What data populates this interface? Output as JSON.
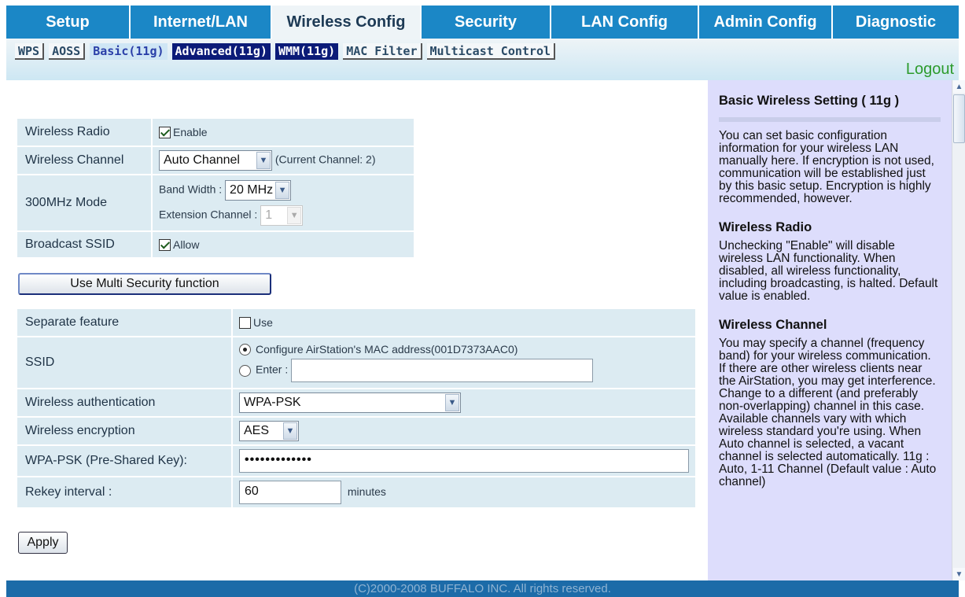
{
  "nav": {
    "tabs": [
      "Setup",
      "Internet/LAN",
      "Wireless Config",
      "Security",
      "LAN Config",
      "Admin Config",
      "Diagnostic"
    ],
    "active": "Wireless Config"
  },
  "subnav": {
    "items": [
      "WPS",
      "AOSS",
      "Basic(11g)",
      "Advanced(11g)",
      "WMM(11g)",
      "MAC Filter",
      "Multicast Control"
    ]
  },
  "logout": "Logout",
  "form1": {
    "radio_label": "Wireless Radio",
    "radio_enable": "Enable",
    "channel_label": "Wireless Channel",
    "channel_value": "Auto Channel",
    "channel_current": "(Current Channel: 2)",
    "mode_label": "300MHz Mode",
    "bandwidth_label": "Band Width :",
    "bandwidth_value": "20 MHz",
    "ext_label": "Extension Channel :",
    "ext_value": "1",
    "ssid_bc_label": "Broadcast SSID",
    "ssid_bc_allow": "Allow"
  },
  "multi_button": "Use Multi Security function",
  "form2": {
    "separate_label": "Separate feature",
    "separate_use": "Use",
    "ssid_label": "SSID",
    "ssid_opt1": "Configure AirStation's MAC address(001D7373AAC0)",
    "ssid_opt2": "Enter :",
    "ssid_enter_value": "",
    "auth_label": "Wireless authentication",
    "auth_value": "WPA-PSK",
    "enc_label": "Wireless encryption",
    "enc_value": "AES",
    "psk_label": "WPA-PSK (Pre-Shared Key):",
    "psk_value": "•••••••••••••",
    "rekey_label": "Rekey interval :",
    "rekey_value": "60",
    "rekey_unit": "minutes"
  },
  "apply_button": "Apply",
  "help": {
    "title": "Basic Wireless Setting ( 11g )",
    "intro": "You can set basic configuration information for your wireless LAN manually here. If encryption is not used, communication will be established just by this basic setup. Encryption is highly recommended, however.",
    "radio_title": "Wireless Radio",
    "radio_text": "Unchecking \"Enable\" will disable wireless LAN functionality. When disabled, all wireless functionality, including broadcasting, is halted. Default value is enabled.",
    "channel_title": "Wireless Channel",
    "channel_text": "You may specify a channel (frequency band) for your wireless communication. If there are other wireless clients near the AirStation, you may get interference. Change to a different (and preferably non-overlapping) channel in this case. Available channels vary with which wireless standard you're using. When Auto channel is selected, a vacant channel is selected automatically. 11g : Auto, 1-11 Channel (Default value : Auto channel)"
  },
  "footer": "(C)2000-2008 BUFFALO INC. All rights reserved."
}
